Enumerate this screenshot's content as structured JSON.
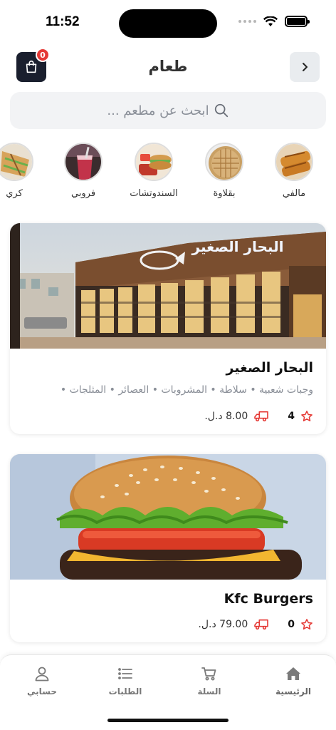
{
  "status_bar": {
    "time": "11:52"
  },
  "header": {
    "title": "طعام",
    "cart_count": "0"
  },
  "search": {
    "placeholder": "ابحث عن مطعم ..."
  },
  "categories": [
    {
      "label": "مالفي",
      "icon": "flatbread"
    },
    {
      "label": "بقلاوة",
      "icon": "baklava"
    },
    {
      "label": "السندوتشات",
      "icon": "sandwich"
    },
    {
      "label": "فروبي",
      "icon": "juice"
    },
    {
      "label": "كري",
      "icon": "crepe"
    }
  ],
  "restaurants": [
    {
      "name": "البحار الصغير",
      "sign_text": "البحار الصغير",
      "tags": "وجبات شعبية • سلاطة • المشروبات • العصائر • المثلجات •",
      "rating": "4",
      "delivery_price": "8.00 د.ل."
    },
    {
      "name": "Kfc Burgers",
      "rating": "0",
      "delivery_price": "79.00 د.ل."
    }
  ],
  "bottom_nav": [
    {
      "label": "الرئيسية",
      "icon": "home-icon",
      "active": true
    },
    {
      "label": "السلة",
      "icon": "cart-icon"
    },
    {
      "label": "الطلبات",
      "icon": "list-icon"
    },
    {
      "label": "حسابي",
      "icon": "user-icon"
    }
  ],
  "colors": {
    "accent": "#e53935",
    "dark": "#1a1f2e",
    "muted": "#8a8f98"
  }
}
